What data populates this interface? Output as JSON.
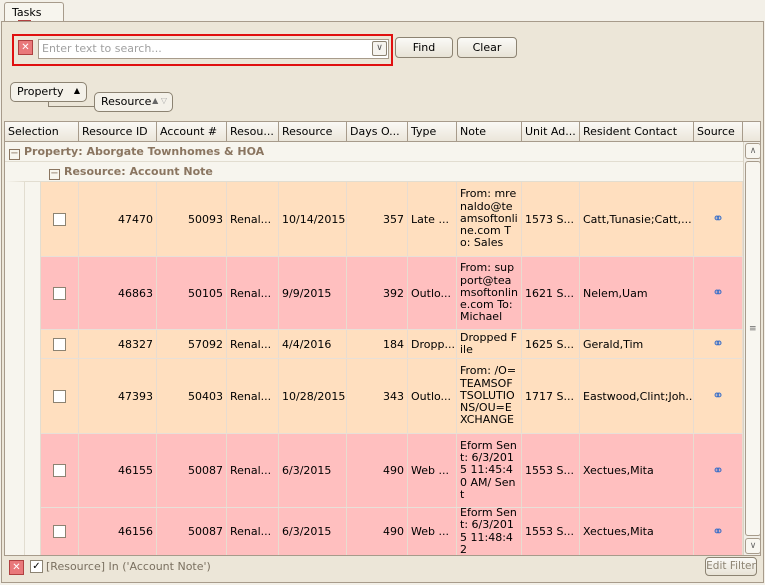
{
  "tab": {
    "label": "Tasks"
  },
  "search": {
    "placeholder": "Enter text to search...",
    "find_label": "Find",
    "clear_label": "Clear"
  },
  "grouping": [
    "Property",
    "Resource"
  ],
  "columns": [
    "Selection",
    "Resource ID",
    "Account #",
    "Resou...",
    "Resource",
    "Days O...",
    "Type",
    "Note",
    "Unit Ad...",
    "Resident Contact",
    "Source"
  ],
  "groups": {
    "property": "Property: Aborgate Townhomes & HOA",
    "resource": "Resource: Account Note"
  },
  "colors": {
    "orange_row": "#ffdfbf",
    "pink_row": "#ffbfbf",
    "highlight": "#e01010"
  },
  "rows": [
    {
      "id": "47470",
      "account": "50093",
      "resou": "Renal...",
      "date": "10/14/2015",
      "days": "357",
      "type": "Late ...",
      "note": "From: mrenaldo@teamsoftonline.com To: Sales",
      "unit": "1573 S...",
      "contact": "Catt,Tunasie;Catt,...",
      "color": "orange"
    },
    {
      "id": "46863",
      "account": "50105",
      "resou": "Renal...",
      "date": "9/9/2015",
      "days": "392",
      "type": "Outlo...",
      "note": "From: support@teamsoftonline.com To: Michael",
      "unit": "1621 S...",
      "contact": "Nelem,Uam",
      "color": "pink"
    },
    {
      "id": "48327",
      "account": "57092",
      "resou": "Renal...",
      "date": "4/4/2016",
      "days": "184",
      "type": "Dropp...",
      "note": "Dropped File",
      "unit": "1625 S...",
      "contact": "Gerald,Tim",
      "color": "orange"
    },
    {
      "id": "47393",
      "account": "50403",
      "resou": "Renal...",
      "date": "10/28/2015",
      "days": "343",
      "type": "Outlo...",
      "note": "From: /O=TEAMSOFTSOLUTIONS/OU=EXCHANGE",
      "unit": "1717 S...",
      "contact": "Eastwood,Clint;Joh...",
      "color": "orange"
    },
    {
      "id": "46155",
      "account": "50087",
      "resou": "Renal...",
      "date": "6/3/2015",
      "days": "490",
      "type": "Web ...",
      "note": "Eform Sent: 6/3/2015 11:45:40 AM/  Sent",
      "unit": "1553 S...",
      "contact": "Xectues,Mita",
      "color": "pink"
    },
    {
      "id": "46156",
      "account": "50087",
      "resou": "Renal...",
      "date": "6/3/2015",
      "days": "490",
      "type": "Web ...",
      "note": "Eform Sent: 6/3/2015 11:48:42",
      "unit": "1553 S...",
      "contact": "Xectues,Mita",
      "color": "pink"
    }
  ],
  "filter": {
    "text": "[Resource] In ('Account Note')",
    "edit_label": "Edit Filter",
    "enabled": true
  }
}
